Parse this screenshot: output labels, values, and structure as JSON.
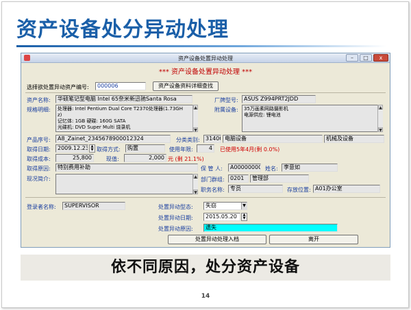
{
  "slide": {
    "title": "资产设备处分异动处理",
    "caption": "依不同原因，处分资产设备",
    "page_number": "14"
  },
  "window": {
    "title": "资产设备处置异动处理",
    "banner": "*** 资产设备处置异动处理 ***",
    "buttons": {
      "minimize": "–",
      "restore": "□",
      "close": "x"
    }
  },
  "query": {
    "label": "选择欲处置异动资产编号:",
    "asset_no": "000006",
    "lookup_button": "资产设备资料详细查找"
  },
  "asset": {
    "name_label": "资产名称:",
    "name": "华硕笔记型电脑 Intel 65奈米新迅驰Santa Rosa",
    "brand_label": "厂牌型号:",
    "brand": "ASUS Z994PRT2JDD",
    "spec_label": "规格明细:",
    "spec_lines": [
      "处理器: Intel Pentium Dual Core T2370处理器(1.73GH",
      "z)",
      "记忆体: 1GB  硬碟: 160G SATA",
      "光碟机: DVD Super Multi 烧录机"
    ],
    "attach_label": "附属设备:",
    "attach_lines": [
      "35万画素网路摄影机",
      "电源供应: 锂电池"
    ],
    "serial_label": "产品序号:",
    "serial": "A8_Zainet_2345678900012324",
    "category_label": "分类类别:",
    "category_code": "31400",
    "category_name": "电脑设备",
    "category_group": "机械及设备",
    "acq_date_label": "取得日期:",
    "acq_date": "2009.12.23",
    "acq_method_label": "取得方式:",
    "acq_method": "购置",
    "life_label": "使用年限:",
    "life": "4",
    "life_note": "已使用5年4月(剩  0.0%)",
    "cost_label": "取得成本:",
    "cost": "25,800",
    "value_label": "现值:",
    "value": "2,000",
    "value_note": "元 (剩 21.1%)",
    "reason_label": "取得原因:",
    "reason": "特别费用补助",
    "keeper_label": "保 管 人:",
    "keeper_id": "A000000001",
    "keeper_name_label": "姓名:",
    "keeper_name": "李意如",
    "status_label": "现况简介:",
    "dept_label": "部门群组:",
    "dept_code": "0201",
    "dept_name": "管理部",
    "title_label": "职务名称:",
    "title": "专员",
    "location_label": "存放位置:",
    "location": "A01办公室"
  },
  "disposal": {
    "recorder_label": "登录者名称:",
    "recorder": "SUPERVISOR",
    "type_label": "处置异动型态:",
    "type": "失窃",
    "date_label": "处置异动日期:",
    "date": "2015.05.20",
    "reason_label": "处置异动原因:",
    "reason": "遗失",
    "submit_button": "处置异动处理入档",
    "exit_button": "离开"
  },
  "colors": {
    "title_blue": "#1a5fa8",
    "banner_red": "#c00000",
    "highlight_cyan": "#00ffff"
  }
}
